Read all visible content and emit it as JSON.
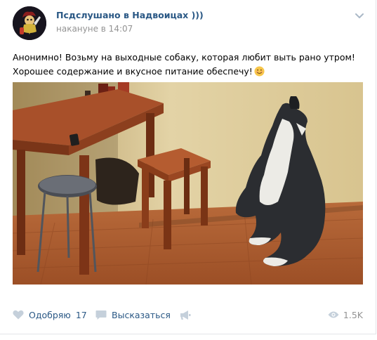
{
  "post": {
    "author": "Псдслушано в Надвоицах )))",
    "time": "накануне в 14:07",
    "text": "Анонимно! Возьму на выходные собаку, которая любит выть рано утром! Хорошее содержание и вкусное питание обеспечу!",
    "emoji": "smiling-face-emoji"
  },
  "actions": {
    "like_label": "Одобряю",
    "like_count": "17",
    "comment_label": "Высказаться",
    "views": "1.5K"
  },
  "icons": [
    "more-chevron-icon",
    "heart-icon",
    "comment-icon",
    "share-megaphone-icon",
    "eye-icon"
  ],
  "colors": {
    "link": "#2a5885",
    "muted": "#939393",
    "icon": "#c5d0db"
  }
}
